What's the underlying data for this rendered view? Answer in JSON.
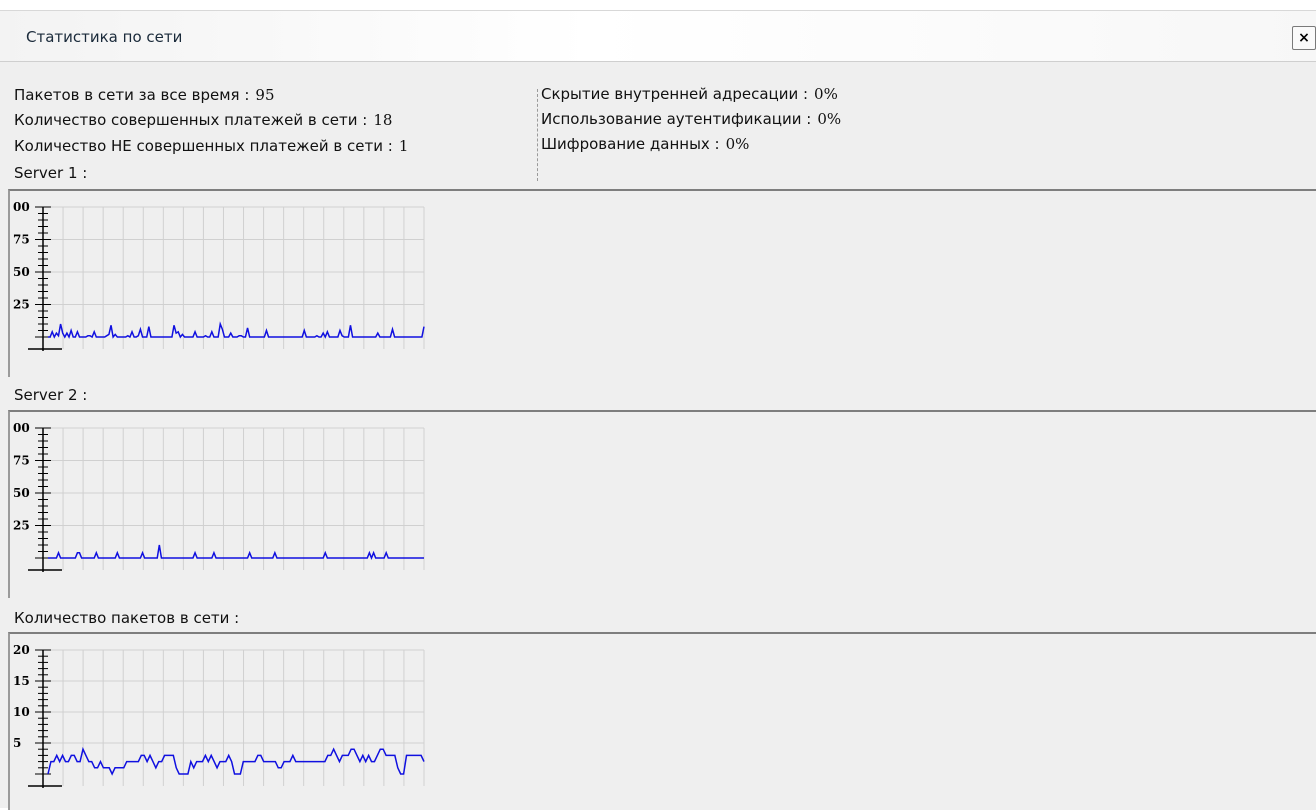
{
  "window": {
    "title": "Статистика по сети",
    "close_label": "×"
  },
  "stats_left": [
    {
      "label": "Пакетов в сети за все время :",
      "value": "95"
    },
    {
      "label": "Количество совершенных платежей в сети :",
      "value": "18"
    },
    {
      "label": "Количество НЕ совершенных платежей в сети :",
      "value": "1"
    }
  ],
  "stats_right": [
    {
      "label": "Скрытие внутренней адресации :",
      "value": "0%"
    },
    {
      "label": "Использование аутентификации :",
      "value": "0%"
    },
    {
      "label": "Шифрование данных :",
      "value": "0%"
    }
  ],
  "panels": [
    {
      "label": "Server 1 :"
    },
    {
      "label": "Server 2 :"
    },
    {
      "label": "Количество пакетов в сети :"
    }
  ],
  "colors": {
    "line": "#1010e0",
    "grid": "#d0d0d0",
    "axis": "#000000"
  },
  "chart_data": [
    {
      "type": "line",
      "title": "Server 1 :",
      "ylim": [
        0,
        100
      ],
      "yticks": [
        "25",
        "50",
        "75",
        "00"
      ],
      "series": [
        {
          "values": [
            0,
            0,
            4,
            0,
            3,
            1,
            10,
            3,
            0,
            3,
            0,
            5,
            0,
            0,
            4,
            0,
            0,
            0,
            0,
            1,
            1,
            0,
            4,
            0,
            0,
            0,
            0,
            0,
            1,
            2,
            9,
            0,
            2,
            0,
            0,
            0,
            0,
            0,
            1,
            0,
            4,
            0,
            0,
            1,
            6,
            0,
            0,
            0,
            8,
            0,
            0,
            0,
            0,
            0,
            0,
            0,
            0,
            0,
            0,
            0,
            9,
            3,
            4,
            0,
            2,
            0,
            0,
            0,
            0,
            0,
            4,
            0,
            0,
            0,
            0,
            1,
            0,
            0,
            4,
            0,
            0,
            0,
            10,
            6,
            0,
            0,
            0,
            3,
            0,
            0,
            0,
            1,
            1,
            0,
            0,
            7,
            0,
            0,
            0,
            0,
            0,
            0,
            0,
            0,
            5,
            0,
            0,
            0,
            0,
            0,
            0,
            0,
            0,
            0,
            0,
            0,
            0,
            0,
            0,
            0,
            0,
            0,
            5,
            0,
            0,
            0,
            0,
            0,
            1,
            0,
            0,
            3,
            0,
            4,
            0,
            0,
            0,
            0,
            0,
            5,
            1,
            0,
            0,
            0,
            9,
            0,
            0,
            0,
            0,
            0,
            0,
            0,
            0,
            0,
            0,
            0,
            0,
            3,
            0,
            0,
            0,
            0,
            0,
            0,
            6,
            0,
            0,
            0,
            0,
            0,
            0,
            0,
            0,
            0,
            0,
            0,
            0,
            0,
            0,
            8,
            0,
            0,
            0,
            0,
            0,
            0,
            5,
            0,
            0,
            0,
            0,
            0,
            0,
            0,
            0,
            0,
            0,
            0,
            9,
            0,
            0,
            0,
            0,
            0,
            0,
            0,
            0,
            0,
            0,
            0,
            0,
            0,
            0,
            0,
            0,
            0,
            0,
            0,
            0,
            0,
            0,
            0,
            0,
            0,
            0,
            0,
            0,
            0,
            0,
            0,
            0,
            0,
            0,
            0,
            0,
            0,
            0,
            0,
            0,
            0,
            0,
            0,
            0,
            0,
            0,
            0,
            0,
            0,
            0,
            0,
            0,
            0,
            0,
            0,
            0,
            0,
            0,
            0,
            0,
            0,
            0,
            0,
            0,
            0,
            0,
            0,
            0,
            0,
            0,
            0,
            0,
            0,
            0,
            0,
            0,
            0,
            0,
            0,
            0,
            0,
            0,
            0,
            0,
            0,
            0,
            0,
            0,
            0,
            0,
            0,
            0,
            0,
            0,
            0,
            0,
            0,
            0,
            0,
            0,
            0,
            0,
            0,
            0,
            0,
            0,
            0,
            0,
            0,
            0,
            0,
            0,
            0,
            0,
            0,
            0,
            0,
            0,
            0,
            0,
            0,
            0,
            0,
            0,
            0,
            0,
            0,
            0,
            0,
            0,
            0,
            0,
            0,
            0,
            0,
            0,
            0,
            0,
            0,
            0,
            0,
            0,
            0,
            0,
            0,
            0,
            0,
            0,
            0,
            0,
            0,
            0,
            0,
            0,
            0,
            0,
            0,
            0,
            0,
            0,
            0,
            0,
            0,
            0,
            0,
            0,
            0,
            0,
            0,
            0,
            0,
            0,
            0,
            0,
            0,
            0,
            0,
            0,
            0,
            0,
            0,
            0,
            0,
            0,
            0,
            0,
            0,
            0,
            0,
            0,
            0,
            0,
            0,
            0,
            0,
            0,
            0,
            0,
            0,
            0,
            0,
            0,
            0,
            0,
            0,
            0,
            0,
            0,
            0,
            0,
            0,
            0,
            0,
            0,
            0,
            0,
            0,
            0,
            0,
            0,
            0,
            0,
            0,
            0,
            0,
            0,
            0,
            0,
            0,
            0,
            0,
            0,
            0,
            0,
            0,
            0,
            0,
            0,
            0,
            0,
            0,
            0,
            0,
            0,
            0,
            0,
            0,
            0,
            0,
            0,
            0,
            0,
            0,
            0,
            0,
            0,
            0,
            0,
            0,
            0,
            0,
            0,
            0,
            0,
            0,
            0,
            0,
            0,
            0,
            0,
            0
          ]
        }
      ]
    },
    {
      "type": "line",
      "title": "Server 2 :",
      "ylim": [
        0,
        100
      ],
      "yticks": [
        "25",
        "50",
        "75",
        "00"
      ],
      "series": [
        {
          "values": [
            0,
            0,
            0,
            0,
            0,
            4,
            0,
            0,
            0,
            0,
            0,
            0,
            0,
            0,
            4,
            4,
            0,
            0,
            0,
            0,
            0,
            0,
            0,
            4,
            0,
            0,
            0,
            0,
            0,
            0,
            0,
            0,
            0,
            4,
            0,
            0,
            0,
            0,
            0,
            0,
            0,
            0,
            0,
            0,
            0,
            4,
            0,
            0,
            0,
            0,
            0,
            0,
            0,
            10,
            0,
            0,
            0,
            0,
            0,
            0,
            0,
            0,
            0,
            0,
            0,
            0,
            0,
            0,
            0,
            0,
            4,
            0,
            0,
            0,
            0,
            0,
            0,
            0,
            0,
            4,
            0,
            0,
            0,
            0,
            0,
            0,
            0,
            0,
            0,
            0,
            0,
            0,
            0,
            0,
            0,
            0,
            4,
            0,
            0,
            0,
            0,
            0,
            0,
            0,
            0,
            0,
            0,
            0,
            4,
            0,
            0,
            0,
            0,
            0,
            0,
            0,
            0,
            0,
            0,
            0,
            0,
            0,
            0,
            0,
            0,
            0,
            0,
            0,
            0,
            0,
            0,
            0,
            4,
            0,
            0,
            0,
            0,
            0,
            0,
            0,
            0,
            0,
            0,
            0,
            0,
            0,
            0,
            0,
            0,
            0,
            0,
            0,
            0,
            4,
            0,
            4,
            0,
            0,
            0,
            0,
            0,
            4,
            0,
            0,
            0,
            0,
            0,
            0,
            0,
            0,
            0,
            0,
            0,
            0,
            0,
            0,
            0,
            0,
            0,
            0,
            0,
            0,
            0,
            0,
            0,
            0,
            0,
            0,
            0,
            0,
            0,
            0,
            0,
            0,
            0,
            0,
            0,
            0,
            0,
            0,
            0,
            0,
            0,
            0,
            0,
            0,
            0,
            0,
            0,
            0,
            0,
            0,
            0,
            0,
            0,
            0,
            0,
            0,
            0,
            0,
            0,
            0,
            0,
            0,
            0,
            0,
            0,
            0,
            0,
            0,
            0,
            0,
            0,
            0,
            0,
            0,
            0,
            0,
            0,
            0,
            0,
            0,
            0,
            0,
            0,
            0,
            0,
            0,
            0,
            0,
            0,
            0,
            0,
            0,
            0,
            0,
            0,
            0,
            0,
            0,
            0,
            0,
            0,
            0,
            0,
            0,
            0,
            0,
            0,
            0,
            0,
            0,
            0,
            0,
            0,
            0,
            0,
            0,
            0,
            0,
            0,
            0,
            0,
            0,
            0,
            0,
            0,
            0,
            0,
            0,
            0,
            0,
            0,
            0,
            0,
            0,
            0,
            0,
            0,
            0,
            0,
            0,
            0,
            0,
            0,
            0,
            0,
            0,
            0,
            0,
            0,
            0,
            0,
            0,
            0,
            0,
            0,
            0,
            0,
            0,
            0,
            0,
            0,
            0,
            0,
            0,
            0,
            0,
            0,
            0,
            0,
            0,
            0,
            0,
            0,
            0,
            0,
            0,
            0,
            0,
            0,
            0,
            0,
            0,
            0,
            0,
            0,
            0,
            0,
            0,
            0,
            0,
            0,
            0,
            0,
            0,
            0,
            0,
            0,
            0,
            0,
            0,
            0,
            0,
            0,
            0,
            0,
            0,
            0,
            0,
            0,
            0,
            0,
            0,
            0,
            0,
            0,
            0,
            0,
            0,
            0,
            0,
            0,
            0,
            0,
            0,
            0,
            0,
            0,
            0,
            0,
            0,
            0,
            0,
            0,
            0,
            0,
            0,
            0,
            0,
            0,
            0,
            0,
            0,
            0,
            0,
            0,
            0,
            0,
            0,
            0,
            0,
            0,
            0,
            0,
            0,
            0,
            0,
            0,
            0,
            0,
            0,
            0,
            0,
            0,
            0,
            0,
            0,
            0,
            0,
            0,
            0,
            0,
            0,
            0,
            0,
            0,
            0,
            0,
            0,
            0,
            0,
            0,
            0,
            0,
            0,
            0,
            0,
            0,
            0,
            0,
            0,
            0,
            0,
            0,
            0,
            0,
            0,
            0,
            0,
            0,
            0,
            0,
            0,
            0,
            0,
            0,
            0,
            0,
            0,
            0,
            0,
            0,
            0,
            0,
            0,
            0,
            0,
            0,
            0,
            0,
            0,
            0,
            0,
            0,
            0,
            0,
            0,
            0,
            0,
            0,
            0,
            0,
            0,
            0,
            0,
            0,
            0,
            0,
            0,
            0,
            0,
            0,
            0,
            0,
            0,
            0,
            0,
            0,
            0,
            0,
            0,
            0,
            0
          ]
        }
      ]
    },
    {
      "type": "line",
      "title": "Количество пакетов в сети :",
      "ylim": [
        0,
        20
      ],
      "yticks": [
        "5",
        "10",
        "15",
        "20"
      ],
      "series": [
        {
          "values": [
            0,
            2,
            2,
            3,
            2,
            3,
            2,
            2,
            3,
            3,
            2,
            2,
            4,
            3,
            2,
            2,
            1,
            1,
            2,
            1,
            1,
            1,
            0,
            1,
            1,
            1,
            1,
            2,
            2,
            2,
            2,
            2,
            3,
            3,
            2,
            3,
            2,
            1,
            2,
            2,
            3,
            3,
            3,
            3,
            1,
            0,
            0,
            0,
            0,
            2,
            1,
            2,
            2,
            2,
            3,
            2,
            3,
            2,
            1,
            2,
            2,
            2,
            3,
            2,
            0,
            0,
            0,
            2,
            2,
            2,
            2,
            2,
            3,
            3,
            2,
            2,
            2,
            2,
            2,
            1,
            1,
            2,
            2,
            2,
            3,
            2,
            2,
            2,
            2,
            2,
            2,
            2,
            2,
            2,
            2,
            2,
            3,
            3,
            4,
            3,
            2,
            3,
            3,
            3,
            4,
            4,
            3,
            2,
            3,
            2,
            3,
            2,
            2,
            3,
            4,
            4,
            3,
            3,
            3,
            3,
            1,
            0,
            0,
            3,
            3,
            3,
            3,
            3,
            3,
            2
          ]
        }
      ]
    }
  ]
}
